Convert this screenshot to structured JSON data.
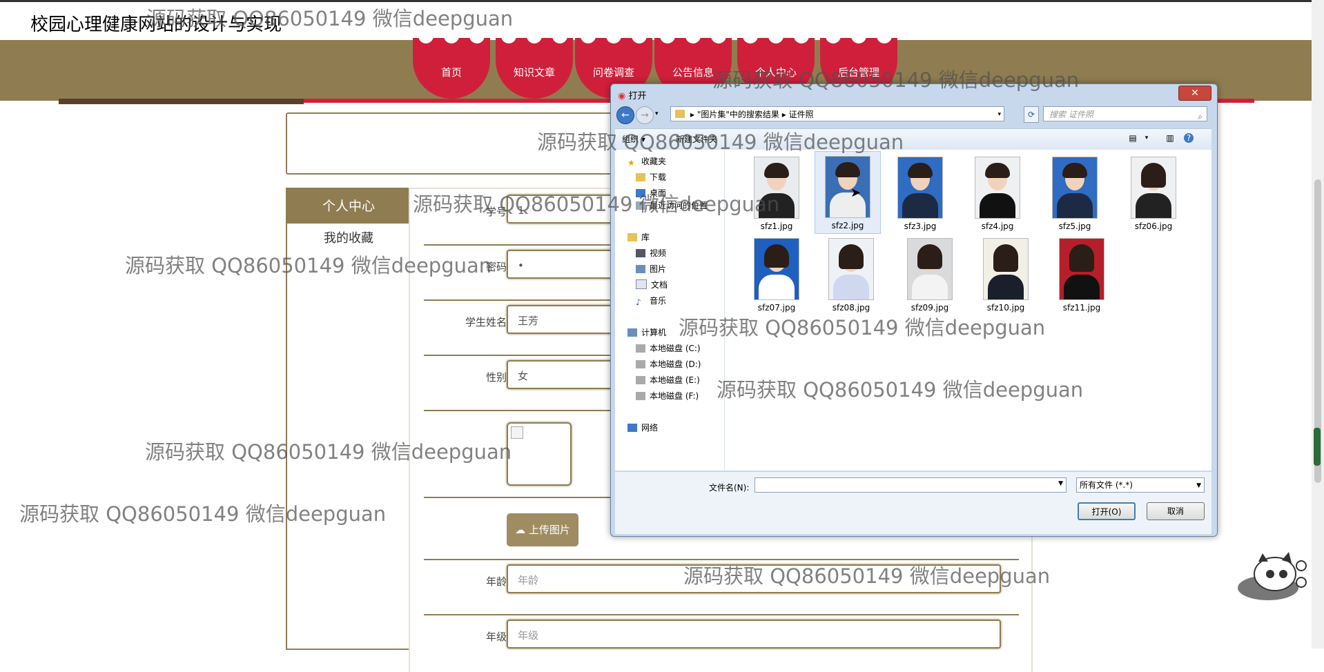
{
  "site": {
    "title": "校园心理健康网站的设计与实现"
  },
  "nav": {
    "items": [
      "首页",
      "知识文章",
      "问卷调查",
      "公告信息",
      "个人中心",
      "后台管理"
    ]
  },
  "sidebar": {
    "title": "个人中心",
    "items": [
      "我的收藏"
    ]
  },
  "form": {
    "fields": [
      {
        "label": "学号",
        "value": "1"
      },
      {
        "label": "密码",
        "value": "•"
      },
      {
        "label": "学生姓名",
        "value": "王芳"
      },
      {
        "label": "性别",
        "value": "女"
      }
    ],
    "upload_label": "上传图片",
    "age": {
      "label": "年龄",
      "placeholder": "年龄"
    },
    "grade": {
      "label": "年级",
      "placeholder": "年级"
    }
  },
  "dialog": {
    "title": "打开",
    "breadcrumb": [
      "\"图片集\"中的搜索结果",
      "证件照"
    ],
    "search_placeholder": "搜索 证件照",
    "toolbar": {
      "organize": "组织 ▾",
      "new_folder": "新建文件夹"
    },
    "nav": {
      "favorites": "收藏夹",
      "favorites_items": [
        "下载",
        "桌面",
        "最近访问的位置"
      ],
      "library": "库",
      "library_items": [
        "视频",
        "图片",
        "文档",
        "音乐"
      ],
      "computer": "计算机",
      "computer_items": [
        "本地磁盘 (C:)",
        "本地磁盘 (D:)",
        "本地磁盘 (E:)",
        "本地磁盘 (F:)"
      ],
      "network": "网络"
    },
    "files": [
      "sfz1.jpg",
      "sfz2.jpg",
      "sfz3.jpg",
      "sfz4.jpg",
      "sfz5.jpg",
      "sfz06.jpg",
      "sfz07.jpg",
      "sfz08.jpg",
      "sfz09.jpg",
      "sfz10.jpg",
      "sfz11.jpg"
    ],
    "filename_label": "文件名(N):",
    "filetype": "所有文件 (*.*)",
    "open_button": "打开(O)",
    "cancel_button": "取消"
  },
  "watermark": "源码获取 QQ86050149 微信deepguan"
}
